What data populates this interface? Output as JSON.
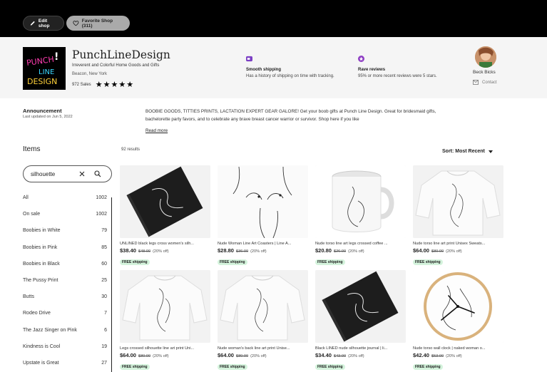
{
  "topbar": {
    "edit_label": "Edit shop",
    "favorite_label": "Favorite Shop (311)"
  },
  "shop": {
    "logo_text": [
      "PUNCH",
      "!",
      "LINE",
      "DESIGN"
    ],
    "name": "PunchLineDesign",
    "tagline": "Irreverent and Colorful Home Goods and Gifts",
    "location": "Beacon, New York",
    "sales": "972 Sales",
    "rating": 5
  },
  "features": [
    {
      "icon": "truck-icon",
      "color": "#7b3fc4",
      "title": "Smooth shipping",
      "desc": "Has a history of shipping on time with tracking."
    },
    {
      "icon": "star-badge-icon",
      "color": "#8f3fc4",
      "title": "Rave reviews",
      "desc": "95% or more recent reviews were 5 stars."
    }
  ],
  "owner": {
    "name": "Beck Bicks",
    "contact_label": "Contact"
  },
  "announcement": {
    "title": "Announcement",
    "date": "Last updated on Jun 5, 2022",
    "text": "BOOBIE GOODS, TITTIES PRINTS, LACTATION EXPERT GEAR GALORE! Get your boob gifts at Punch Line Design. Great for bridesmaid gifts, bachelorette party favors, and to celebrate any brave breast cancer warrior or survivor. Shop here if you like",
    "read_more": "Read more"
  },
  "sidebar": {
    "title": "Items",
    "search_value": "silhouette",
    "categories": [
      {
        "label": "All",
        "count": "1002"
      },
      {
        "label": "On sale",
        "count": "1002"
      },
      {
        "label": "Boobies in White",
        "count": "79"
      },
      {
        "label": "Boobies in Pink",
        "count": "85"
      },
      {
        "label": "Boobies in Black",
        "count": "60"
      },
      {
        "label": "The Pussy Print",
        "count": "25"
      },
      {
        "label": "Butts",
        "count": "30"
      },
      {
        "label": "Rodeo Drive",
        "count": "7"
      },
      {
        "label": "The Jazz Singer on Pink",
        "count": "6"
      },
      {
        "label": "Kindness is Cool",
        "count": "19"
      },
      {
        "label": "Upstate is Great",
        "count": "27"
      }
    ]
  },
  "results": {
    "count": "92 results",
    "sort_label": "Sort: Most Recent"
  },
  "products": [
    {
      "title": "UNLINED black legs cross women's silh...",
      "price": "$38.40",
      "orig": "$48.00",
      "off": "(20% off)",
      "ship": "FREE shipping",
      "image": "black-journal"
    },
    {
      "title": "Nude Woman Line Art Coasters | Line A...",
      "price": "$28.80",
      "orig": "$36.00",
      "off": "(20% off)",
      "ship": "FREE shipping",
      "image": "torso-print"
    },
    {
      "title": "Nude torso line art legs crossed coffee ...",
      "price": "$20.80",
      "orig": "$26.00",
      "off": "(20% off)",
      "ship": "FREE shipping",
      "image": "mug"
    },
    {
      "title": "Nude torso line art print Unisex Sweats...",
      "price": "$64.00",
      "orig": "$80.00",
      "off": "(20% off)",
      "ship": "FREE shipping",
      "image": "sweatshirt"
    },
    {
      "title": "Legs crossed silhouette line art print Uni...",
      "price": "$64.00",
      "orig": "$80.00",
      "off": "(20% off)",
      "ship": "FREE shipping",
      "image": "sweatshirt"
    },
    {
      "title": "Nude woman's back line art print Unise...",
      "price": "$64.00",
      "orig": "$80.00",
      "off": "(20% off)",
      "ship": "FREE shipping",
      "image": "sweatshirt"
    },
    {
      "title": "Black LINED nude silhouette journal | li...",
      "price": "$34.40",
      "orig": "$43.00",
      "off": "(20% off)",
      "ship": "FREE shipping",
      "image": "black-journal"
    },
    {
      "title": "Nude torso wall clock | naked woman o...",
      "price": "$42.40",
      "orig": "$53.00",
      "off": "(20% off)",
      "ship": "FREE shipping",
      "image": "clock"
    }
  ]
}
